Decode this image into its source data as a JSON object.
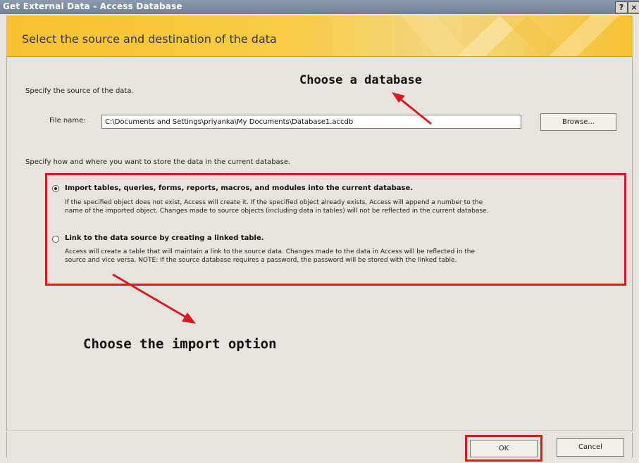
{
  "window": {
    "title": "Get External Data - Access Database",
    "help_label": "?",
    "close_label": "×"
  },
  "banner": {
    "heading": "Select the source and destination of the data"
  },
  "source": {
    "prompt": "Specify the source of the data.",
    "file_label": "File name:",
    "file_value": "C:\\Documents and Settings\\priyanka\\My Documents\\Database1.accdb",
    "browse_label": "Browse..."
  },
  "destination": {
    "prompt": "Specify how and where you want to store the data in the current database.",
    "options": [
      {
        "title": "Import tables, queries, forms, reports, macros, and modules into the current database.",
        "desc1": "If the specified object does not exist, Access will create it. If the specified object already exists, Access will append a number to the",
        "desc2": "name of the imported object. Changes made to source objects (including data in tables) will not be reflected in the current database.",
        "selected": true
      },
      {
        "title": "Link to the data source by creating a linked table.",
        "desc1": "Access will create a table that will maintain a link to the source data. Changes made to the data in Access will be reflected in the",
        "desc2": "source and vice versa. NOTE: If the source database requires a password, the password will be stored with the linked table.",
        "selected": false
      }
    ]
  },
  "annotations": {
    "database": "Choose a database",
    "import": "Choose the import option"
  },
  "footer": {
    "ok_label": "OK",
    "cancel_label": "Cancel"
  },
  "colors": {
    "highlight": "#d81a22",
    "banner": "#f7c230"
  }
}
